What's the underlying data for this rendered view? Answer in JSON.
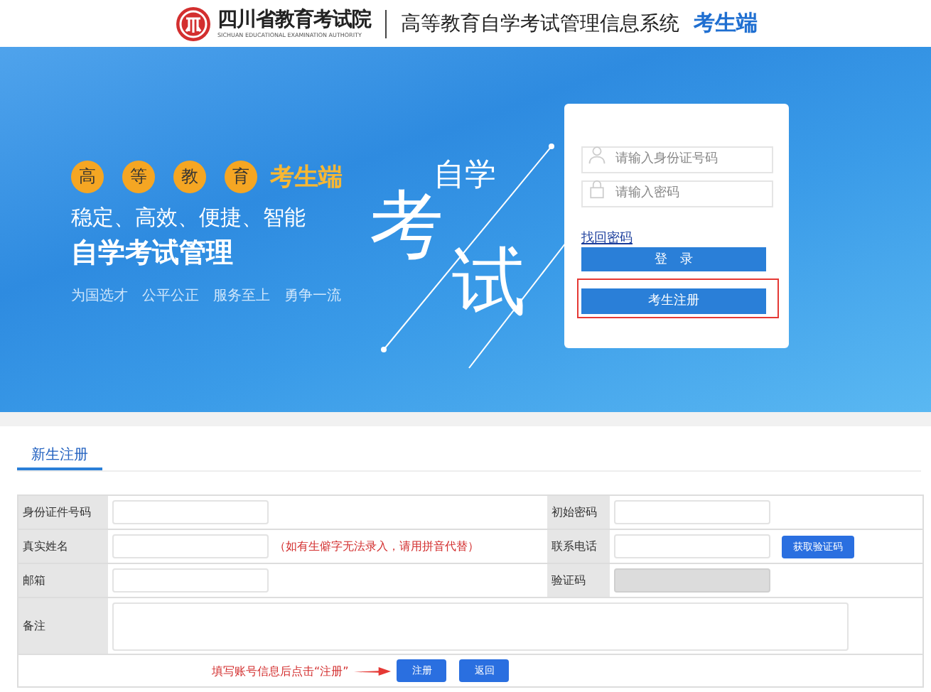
{
  "header": {
    "institute": "四川省教育考试院",
    "institute_en": "SICHUAN EDUCATIONAL EXAMINATION AUTHORITY",
    "system": "高等教育自学考试管理信息系统",
    "portal": "考生端"
  },
  "banner": {
    "badges": [
      "高",
      "等",
      "教",
      "育"
    ],
    "badge_suffix": "考生端",
    "slogan": "稳定、高效、便捷、智能",
    "headline": "自学考试管理",
    "mottos": [
      "为国选才",
      "公平公正",
      "服务至上",
      "勇争一流"
    ],
    "art_small": "自学",
    "art_big": [
      "考",
      "试"
    ]
  },
  "login": {
    "fields": [
      {
        "kind": "user",
        "placeholder": "请输入身份证号码"
      },
      {
        "kind": "lock",
        "placeholder": "请输入密码"
      }
    ],
    "forgot": "找回密码",
    "login_button": "登　录",
    "register_button": {
      "label": "考生注册",
      "highlighted": true
    }
  },
  "form": {
    "tab": {
      "label": "新生注册",
      "selected": true
    },
    "rows": [
      {
        "kind": "input",
        "label": "身份证件号码",
        "right_label": "初始密码",
        "right_disabled": false
      },
      {
        "kind": "input",
        "label": "真实姓名",
        "note": "（如有生僻字无法录入，请用拼音代替）",
        "right_label": "联系电话",
        "right_button": "获取验证码",
        "right_disabled": false
      },
      {
        "kind": "input",
        "label": "邮箱",
        "right_label": "验证码",
        "right_disabled": true
      },
      {
        "kind": "textarea",
        "label": "备注"
      }
    ],
    "hint": "填写账号信息后点击“注册”",
    "buttons": [
      "注册",
      "返回"
    ]
  }
}
